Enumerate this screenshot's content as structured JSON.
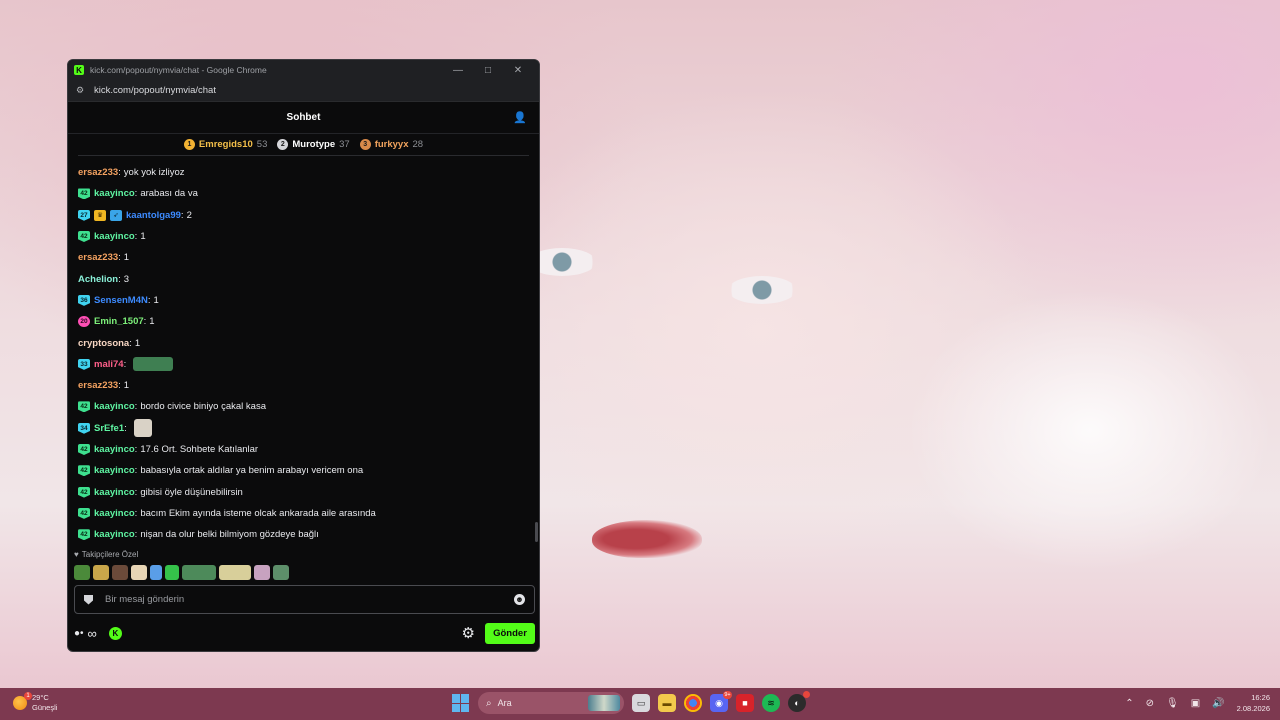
{
  "window": {
    "title": "kick.com/popout/nymvia/chat - Google Chrome",
    "url": "kick.com/popout/nymvia/chat",
    "controls": {
      "minimize": "—",
      "maximize": "□",
      "close": "✕"
    }
  },
  "chat": {
    "title": "Sohbet",
    "leaderboard": [
      {
        "rank": "1",
        "name": "Emregids10",
        "score": "53",
        "color": "#f5c04a",
        "medal": "#f2b233"
      },
      {
        "rank": "2",
        "name": "Murotype",
        "score": "37",
        "color": "#ffffff",
        "medal": "#d5d6da"
      },
      {
        "rank": "3",
        "name": "furkyyx",
        "score": "28",
        "color": "#f2a45e",
        "medal": "#d98a4a"
      }
    ],
    "messages": [
      {
        "user": "ersaz233",
        "text": "yok yok izliyoz",
        "color": "#f4a261"
      },
      {
        "badge": "42",
        "user": "kaayinco",
        "text": "arabası da va",
        "color": "#5ff5a3"
      },
      {
        "badge": "27",
        "user": "kaantolga99",
        "text": "2",
        "color": "#3d8bff"
      },
      {
        "badge": "42",
        "user": "kaayinco",
        "text": "1",
        "color": "#5ff5a3"
      },
      {
        "user": "ersaz233",
        "text": "1",
        "color": "#f4a261"
      },
      {
        "user": "Achelion",
        "text": "3",
        "color": "#8af0d8"
      },
      {
        "badge": "36",
        "user": "SensenM4N",
        "text": "1",
        "color": "#3d8bff"
      },
      {
        "badge": "20",
        "user": "Emin_1507",
        "text": "1",
        "color": "#7df07a"
      },
      {
        "user": "cryptosona",
        "text": "1",
        "color": "#f7d6c3"
      },
      {
        "badge": "33",
        "user": "mali74",
        "text": "",
        "color": "#ff5f8a"
      },
      {
        "user": "ersaz233",
        "text": "1",
        "color": "#f4a261"
      },
      {
        "badge": "42",
        "user": "kaayinco",
        "text": "bordo civice biniyo çakal kasa",
        "color": "#5ff5a3"
      },
      {
        "badge": "34",
        "user": "SrEfe1",
        "text": "",
        "color": "#5ff5a3"
      },
      {
        "badge": "42",
        "user": "kaayinco",
        "text": "17.6 Ort. Sohbete Katılanlar",
        "color": "#5ff5a3"
      },
      {
        "badge": "42",
        "user": "kaayinco",
        "text": "babasıyla ortak aldılar ya benim arabayı vericem ona",
        "color": "#5ff5a3"
      },
      {
        "badge": "42",
        "user": "kaayinco",
        "text": "gibisi öyle düşünebilirsin",
        "color": "#5ff5a3"
      },
      {
        "badge": "42",
        "user": "kaayinco",
        "text": "bacım Ekim ayında isteme olcak ankarada aile arasında",
        "color": "#5ff5a3"
      },
      {
        "badge": "42",
        "user": "kaayinco",
        "text": "nişan da olur belki bilmiyom gözdeye bağlı",
        "color": "#5ff5a3"
      }
    ],
    "followers_label": "Takipçilere Özel",
    "input_placeholder": "Bir mesaj gönderin",
    "send_label": "Gönder"
  },
  "taskbar": {
    "weather_temp": "29°C",
    "weather_desc": "Güneşli",
    "weather_badge": "1",
    "search_label": "Ara",
    "discord_badge": "9+",
    "time": "16:26",
    "date": "2.08.2026"
  },
  "colors": {
    "kick_green": "#53fc18",
    "taskbar": "#7d3950"
  }
}
